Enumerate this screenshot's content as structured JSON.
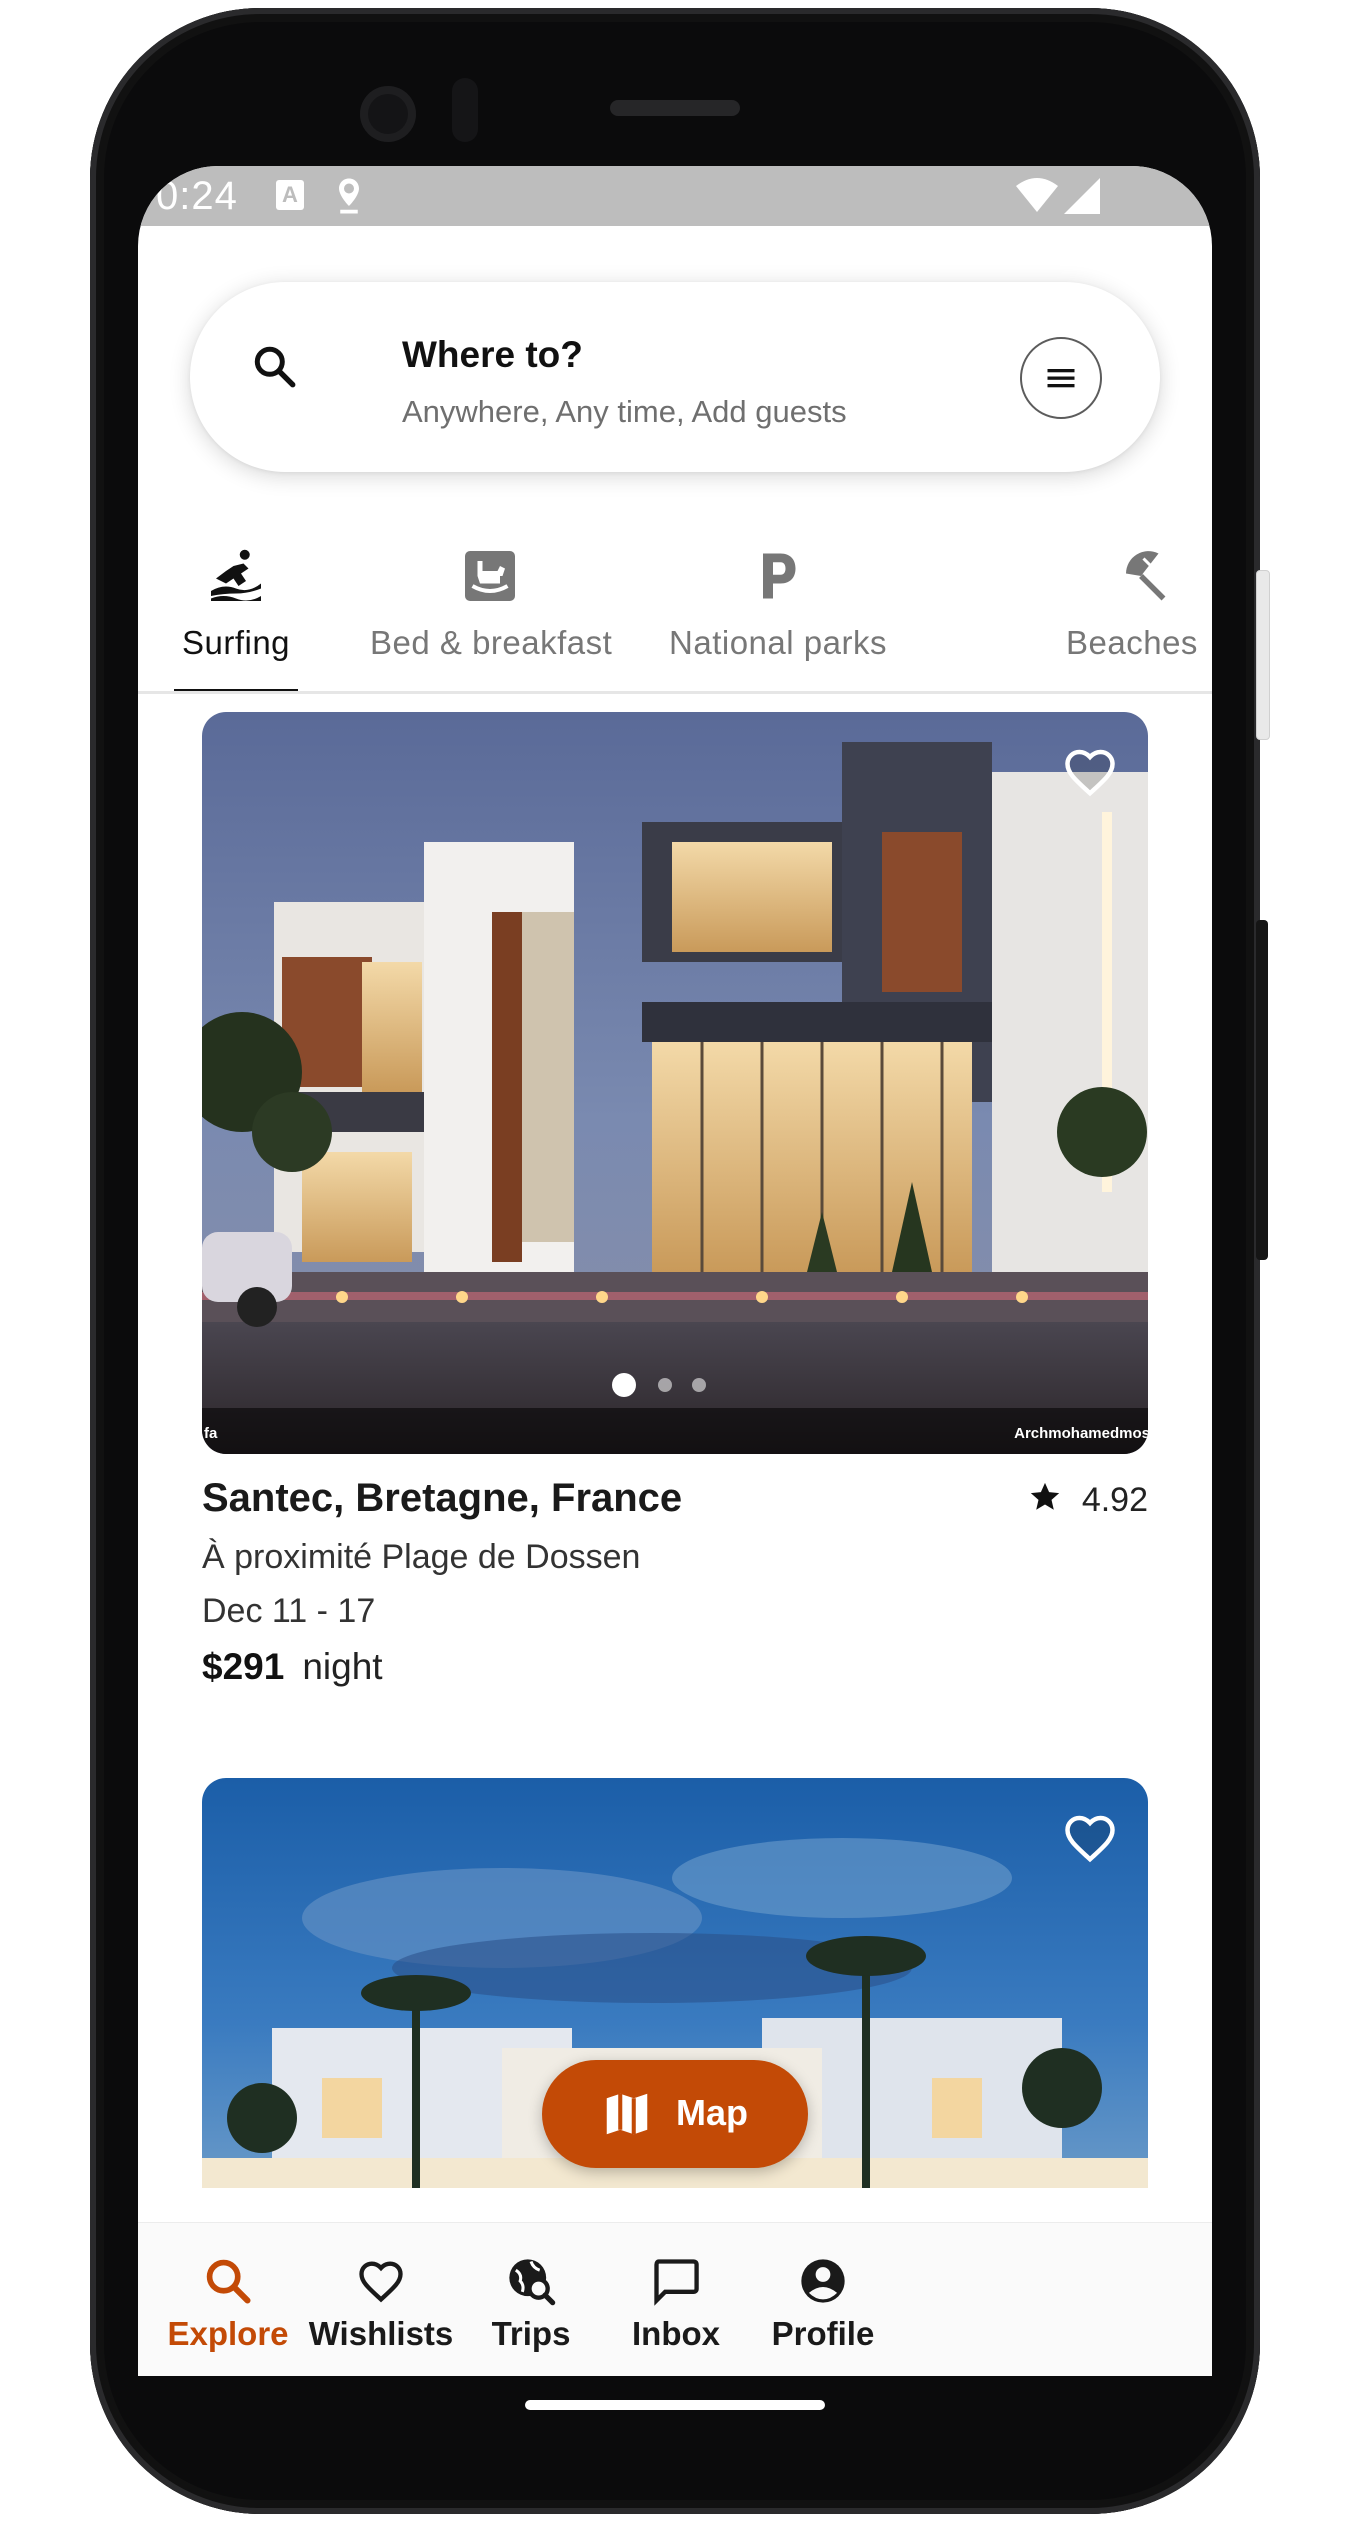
{
  "status_bar": {
    "time": "0:24",
    "a_icon": "A"
  },
  "search": {
    "title": "Where to?",
    "subtitle": "Anywhere, Any time, Add guests"
  },
  "categories": [
    {
      "label": "Surfing",
      "icon": "surfing-icon",
      "active": true
    },
    {
      "label": "Bed & breakfast",
      "icon": "rocking-horse-icon",
      "active": false
    },
    {
      "label": "National parks",
      "icon": "parking-p-icon",
      "active": false
    },
    {
      "label": "Beaches",
      "icon": "beach-umbrella-icon",
      "active": false
    }
  ],
  "listings": [
    {
      "title": "Santec, Bretagne, France",
      "rating": "4.92",
      "subtitle": "À proximité Plage de Dossen",
      "dates": "Dec 11 - 17",
      "price": "$291",
      "price_unit": "night",
      "credit_left": "fa",
      "credit_right": "Archmohamedmos",
      "photo_index": 1,
      "photo_count": 3
    }
  ],
  "map_button": {
    "label": "Map"
  },
  "bottom_nav": [
    {
      "label": "Explore",
      "icon": "search-icon",
      "active": true
    },
    {
      "label": "Wishlists",
      "icon": "heart-icon",
      "active": false
    },
    {
      "label": "Trips",
      "icon": "globe-search-icon",
      "active": false
    },
    {
      "label": "Inbox",
      "icon": "message-icon",
      "active": false
    },
    {
      "label": "Profile",
      "icon": "account-icon",
      "active": false
    }
  ],
  "colors": {
    "accent": "#c34a06",
    "text": "#1a1a1a",
    "muted": "#777777"
  }
}
